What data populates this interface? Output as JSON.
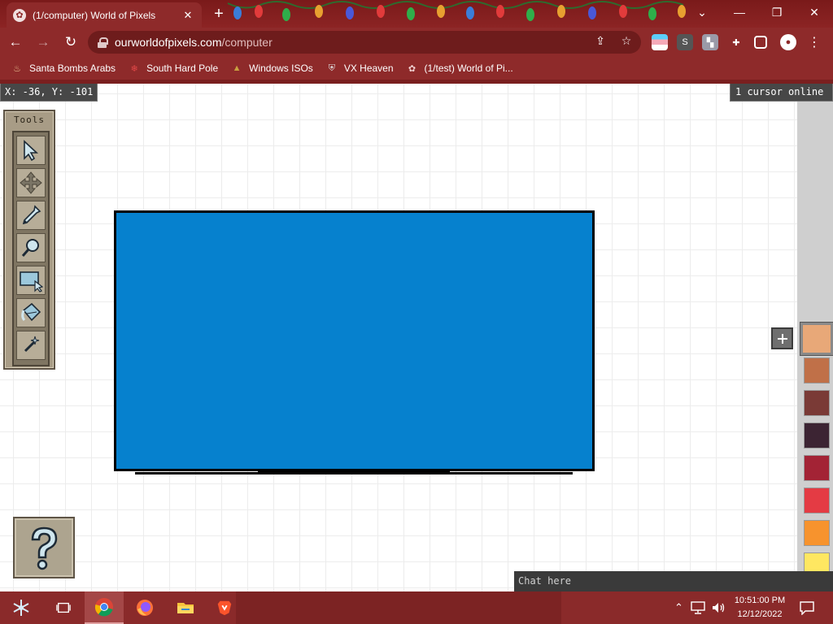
{
  "browser": {
    "tab_title": "(1/computer) World of Pixels",
    "url_host": "ourworldofpixels.com",
    "url_path": "/computer",
    "bookmarks": [
      {
        "label": "Santa Bombs Arabs",
        "icon": "flame-icon"
      },
      {
        "label": "South Hard Pole",
        "icon": "snowflake-icon"
      },
      {
        "label": "Windows ISOs",
        "icon": "tree-icon"
      },
      {
        "label": "VX Heaven",
        "icon": "shield-icon"
      },
      {
        "label": "(1/test) World of Pi...",
        "icon": "palette-icon"
      }
    ],
    "window_controls": {
      "minimize": "—",
      "restore": "❐",
      "close": "✕",
      "tab_list": "⌄"
    }
  },
  "owop": {
    "coords": "X: -36, Y: -101",
    "online": "1 cursor online",
    "tools_title": "Tools",
    "tools": [
      {
        "name": "cursor",
        "icon": "cursor-arrow-icon"
      },
      {
        "name": "move",
        "icon": "move-arrows-icon"
      },
      {
        "name": "pipette",
        "icon": "eyedropper-icon"
      },
      {
        "name": "zoom",
        "icon": "magnifier-icon"
      },
      {
        "name": "export",
        "icon": "export-area-icon"
      },
      {
        "name": "fill",
        "icon": "paint-bucket-icon"
      },
      {
        "name": "line",
        "icon": "wand-icon"
      }
    ],
    "drawn_color": "#0681ce",
    "palette": [
      "#e8a878",
      "#c07048",
      "#7a3a36",
      "#3c2433",
      "#a32335",
      "#e43b44",
      "#f7932d",
      "#fee761",
      "#3f3f3f"
    ],
    "selected_palette_index": 0,
    "chat_placeholder": "Chat here",
    "help_glyph": "?"
  },
  "taskbar": {
    "time": "10:51:00 PM",
    "date": "12/12/2022",
    "apps": [
      "start-snowflake",
      "task-view",
      "chrome",
      "firefox",
      "file-explorer",
      "brave"
    ]
  },
  "colors": {
    "chrome_red": "#8e2a2a",
    "tool_panel": "#a89c86"
  }
}
